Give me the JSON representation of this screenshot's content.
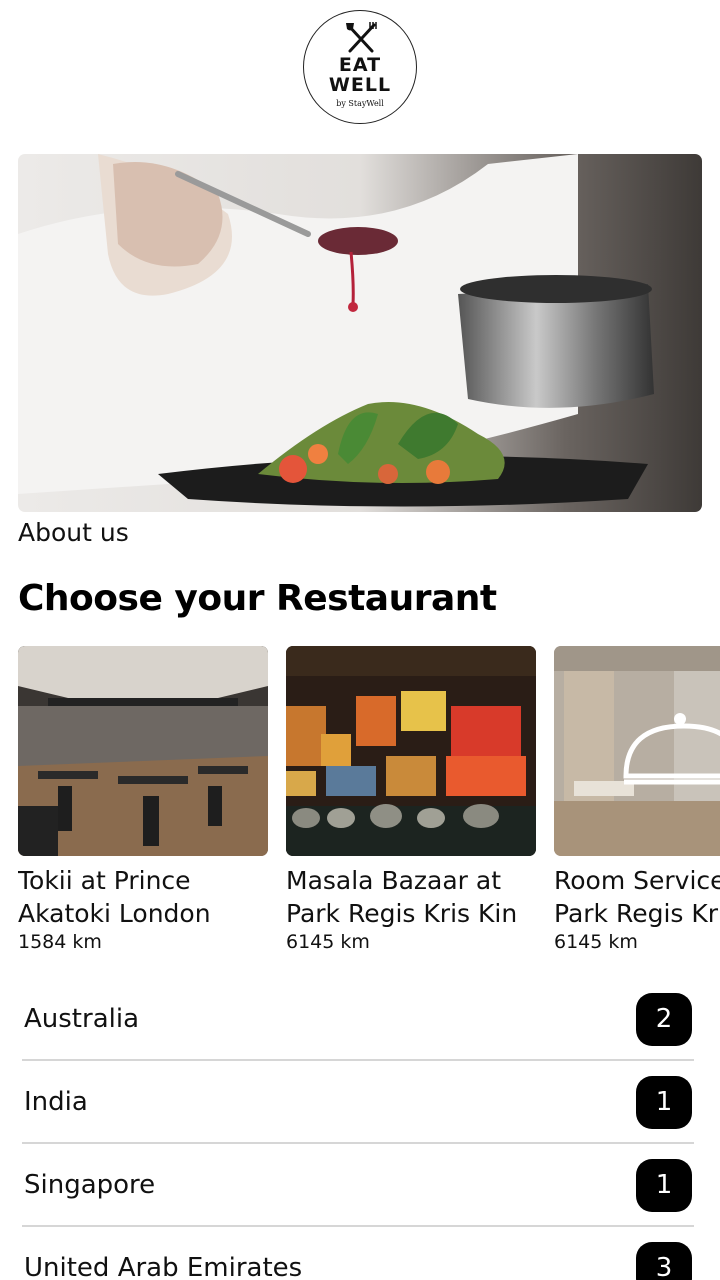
{
  "logo": {
    "line1": "EAT",
    "line2": "WELL",
    "tagline": "by StayWell",
    "icon": "crossed-cutlery-icon"
  },
  "hero": {
    "image": "chef-plating-dish-photo"
  },
  "about": {
    "label": "About us"
  },
  "restaurants": {
    "title": "Choose your Restaurant",
    "items": [
      {
        "name_line1": "Tokii at Prince",
        "name_line2": "Akatoki London",
        "distance": "1584 km",
        "image": "restaurant-interior-photo"
      },
      {
        "name_line1": "Masala Bazaar at",
        "name_line2": "Park Regis Kris Kin",
        "distance": "6145 km",
        "image": "colorful-art-wall-restaurant-photo"
      },
      {
        "name_line1": "Room Service",
        "name_line2": "Park Regis Kri",
        "distance": "6145 km",
        "image": "room-service-cloche-icon"
      }
    ]
  },
  "countries": [
    {
      "name": "Australia",
      "count": "2"
    },
    {
      "name": "India",
      "count": "1"
    },
    {
      "name": "Singapore",
      "count": "1"
    },
    {
      "name": "United Arab Emirates",
      "count": "3"
    }
  ]
}
